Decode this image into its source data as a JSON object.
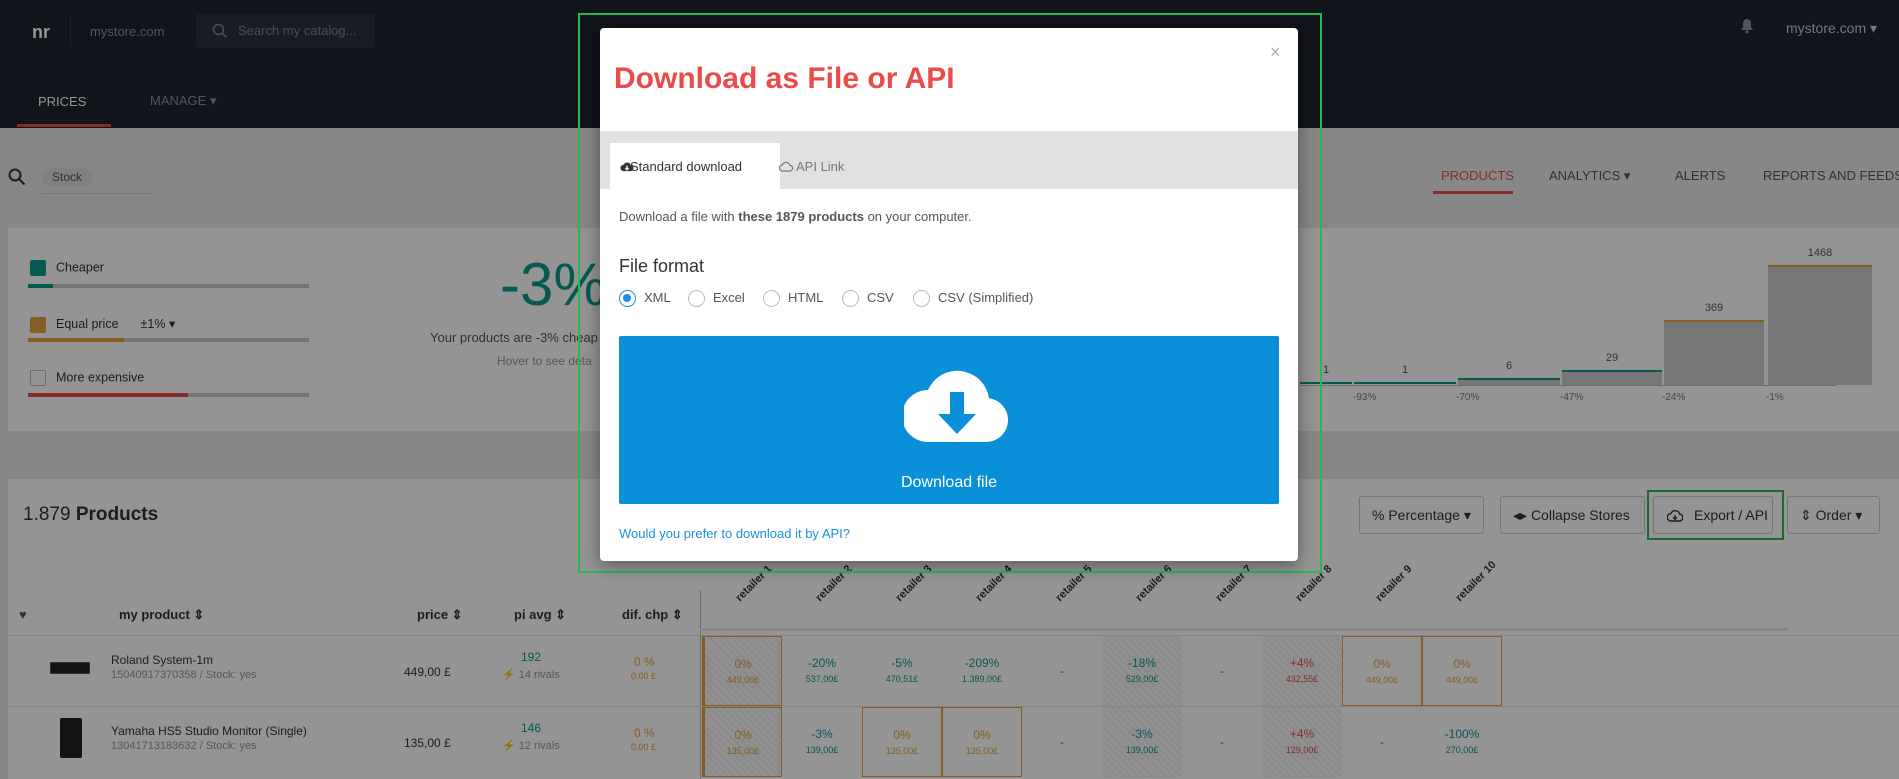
{
  "topbar": {
    "logo": "nr",
    "store": "mystore.com",
    "search_placeholder": "Search my catalog...",
    "store_right": "mystore.com ▾",
    "tabs": [
      "PRICES",
      "MANAGE ▾"
    ]
  },
  "filterbar": {
    "chip": "Stock",
    "tabs": [
      "PRODUCTS",
      "ANALYTICS ▾",
      "ALERTS",
      "REPORTS AND FEEDS"
    ]
  },
  "summary": {
    "legend": [
      {
        "label": "Cheaper",
        "checked": true,
        "color": "#0a9a8a",
        "fill": 0.09
      },
      {
        "label": "Equal price",
        "extra": "±1% ▾",
        "checked": true,
        "color": "#e8a33a",
        "fill": 0.34
      },
      {
        "label": "More expensive",
        "checked": false,
        "color": "#e94b4b",
        "fill": 0.57
      }
    ],
    "big_value": "-3%",
    "caption": "Your products are -3% cheap",
    "hover": "Hover to see deta"
  },
  "histogram": {
    "counts": [
      "1",
      "1",
      "6",
      "29",
      "369",
      "1468"
    ],
    "count_values": [
      1,
      1,
      6,
      29,
      369,
      1468
    ],
    "ticks": [
      "-93%",
      "-70%",
      "-47%",
      "-24%",
      "-1%"
    ]
  },
  "products": {
    "count": "1.879",
    "label": "Products",
    "buttons": [
      "% Percentage ▾",
      "◂▸ Collapse Stores",
      "Export / API",
      "⇕ Order ▾"
    ],
    "headers": {
      "fav": "♥",
      "product": "my product ⇕",
      "price": "price ⇕",
      "pi": "pi avg ⇕",
      "dif": "dif. chp ⇕"
    },
    "retailers": [
      "retailer 1",
      "retailer 2",
      "retailer 3",
      "retailer 4",
      "retailer 5",
      "retailer 6",
      "retailer 7",
      "retailer 8",
      "retailer 9",
      "retailer 10"
    ],
    "rows": [
      {
        "name": "Roland System-1m",
        "sub": "15040917370358 / Stock: yes",
        "price": "449,00 £",
        "pi": "192",
        "rivals": "14 rivals",
        "dif": "0 %",
        "dif_sub": "0.00 £",
        "cells": [
          [
            "0%",
            "449,00£"
          ],
          [
            "-20%",
            "537,00£"
          ],
          [
            "-5%",
            "470,51£"
          ],
          [
            "-209%",
            "1.389,00£"
          ],
          [
            "-",
            ""
          ],
          [
            "-18%",
            "529,00£"
          ],
          [
            "-",
            ""
          ],
          [
            "+4%",
            "432,55£"
          ],
          [
            "0%",
            "449,00£"
          ],
          [
            "0%",
            "449,00£"
          ]
        ]
      },
      {
        "name": "Yamaha HS5 Studio Monitor (Single)",
        "sub": "13041713183632 / Stock: yes",
        "price": "135,00 £",
        "pi": "146",
        "rivals": "12 rivals",
        "dif": "0 %",
        "dif_sub": "0.00 £",
        "cells": [
          [
            "0%",
            "135,00£"
          ],
          [
            "-3%",
            "139,00£"
          ],
          [
            "0%",
            "135,00£"
          ],
          [
            "0%",
            "135,00£"
          ],
          [
            "-",
            ""
          ],
          [
            "-3%",
            "139,00£"
          ],
          [
            "-",
            ""
          ],
          [
            "+4%",
            "129,00£"
          ],
          [
            "-",
            ""
          ],
          [
            "-100%",
            "270,00£"
          ]
        ]
      }
    ]
  },
  "modal": {
    "title": "Download as File or API",
    "close": "×",
    "tab_standard": "Standard download",
    "tab_api": "API Link",
    "desc_pre": "Download a file with ",
    "desc_bold": "these 1879 products",
    "desc_post": " on your computer.",
    "format_title": "File format",
    "formats": [
      "XML",
      "Excel",
      "HTML",
      "CSV",
      "CSV (Simplified)"
    ],
    "selected_format": "XML",
    "download_label": "Download file",
    "api_link": "Would you prefer to download it by API?"
  }
}
